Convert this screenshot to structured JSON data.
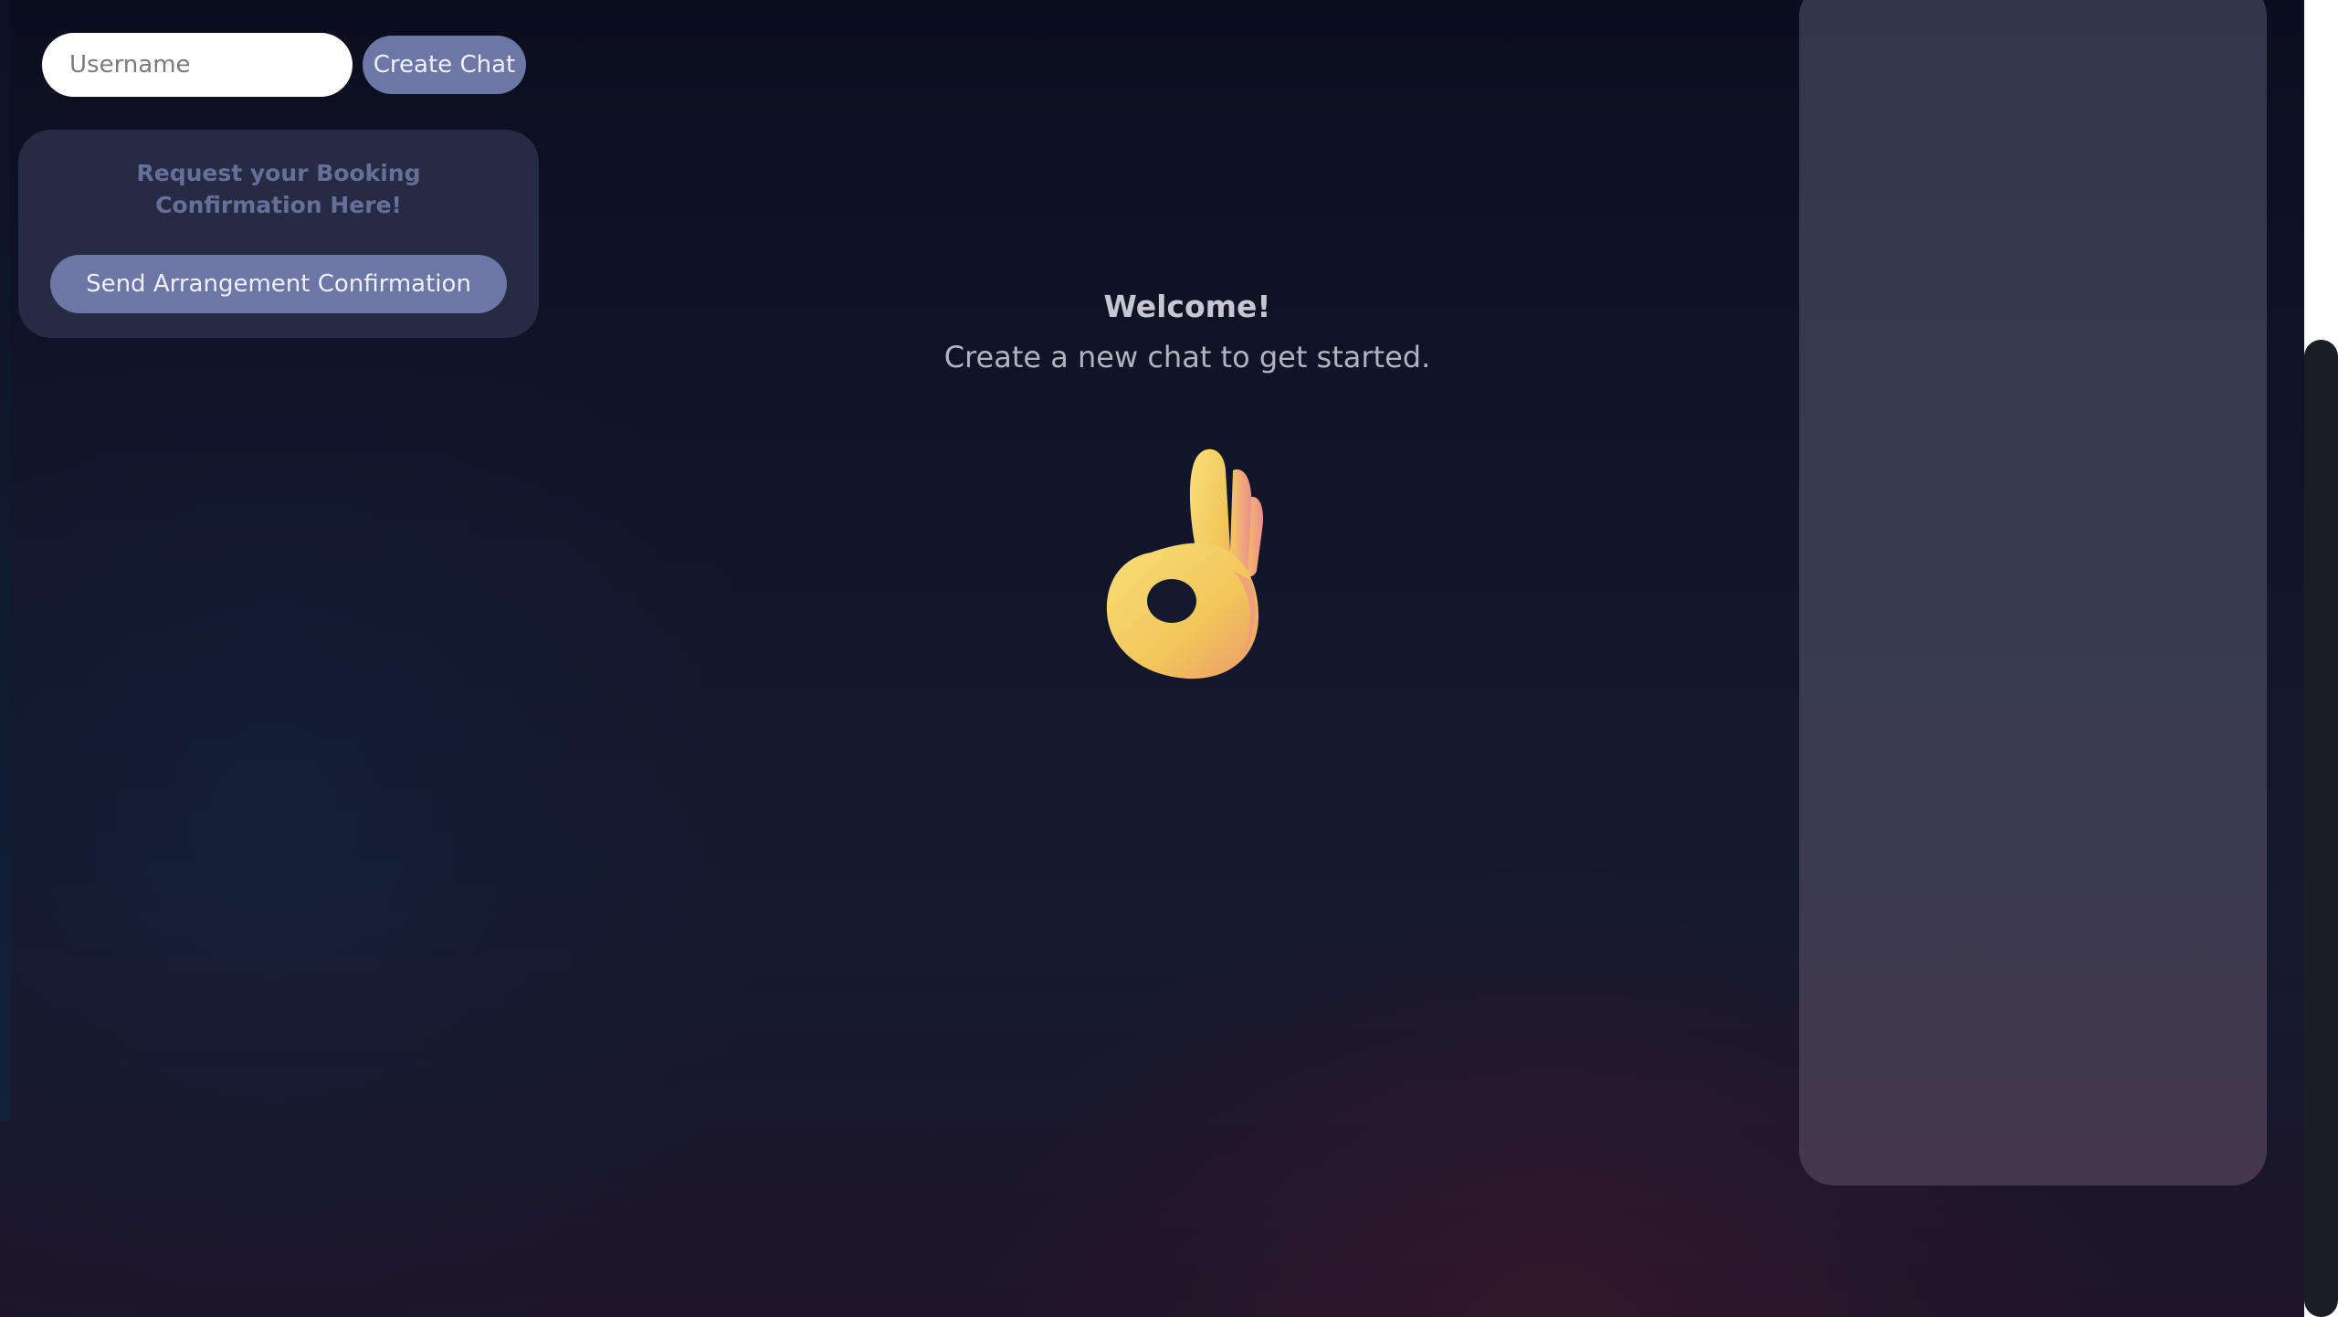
{
  "header": {
    "username_placeholder": "Username",
    "create_chat_label": "Create Chat"
  },
  "booking": {
    "title": "Request your Booking Confirmation Here!",
    "send_label": "Send Arrangement Confirmation"
  },
  "welcome": {
    "title": "Welcome!",
    "subtitle": "Create a new chat to get started.",
    "image": "ok-hand-emoji"
  },
  "colors": {
    "background": "#11162a",
    "accent": "#6d76a4",
    "card": "#262b44",
    "panel": "#353b4e"
  }
}
